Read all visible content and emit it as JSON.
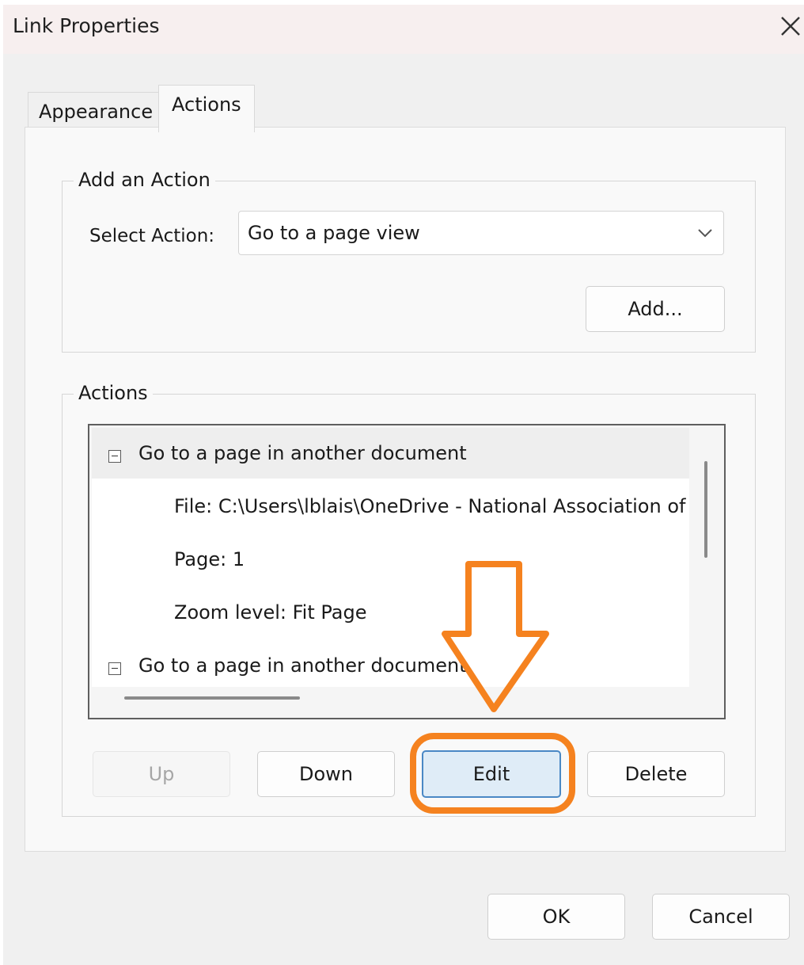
{
  "dialog": {
    "title": "Link Properties",
    "close_icon": "close-icon"
  },
  "tabs": [
    {
      "label": "Appearance",
      "selected": false
    },
    {
      "label": "Actions",
      "selected": true
    }
  ],
  "add_action": {
    "group_label": "Add an Action",
    "select_label": "Select Action:",
    "select_value": "Go to a page view",
    "add_button": "Add..."
  },
  "actions": {
    "group_label": "Actions",
    "items": [
      {
        "label": "Go to a page in another document",
        "expanded": true,
        "details": [
          "File: C:\\Users\\lblais\\OneDrive - National Association of",
          "Page: 1",
          "Zoom level: Fit Page"
        ]
      },
      {
        "label": "Go to a page in another document",
        "expanded": true
      }
    ],
    "buttons": {
      "up": "Up",
      "down": "Down",
      "edit": "Edit",
      "delete": "Delete"
    }
  },
  "footer": {
    "ok": "OK",
    "cancel": "Cancel"
  },
  "annotation": {
    "color": "#f5821f",
    "arrow_icon": "down-arrow-icon",
    "highlight": "Edit"
  }
}
